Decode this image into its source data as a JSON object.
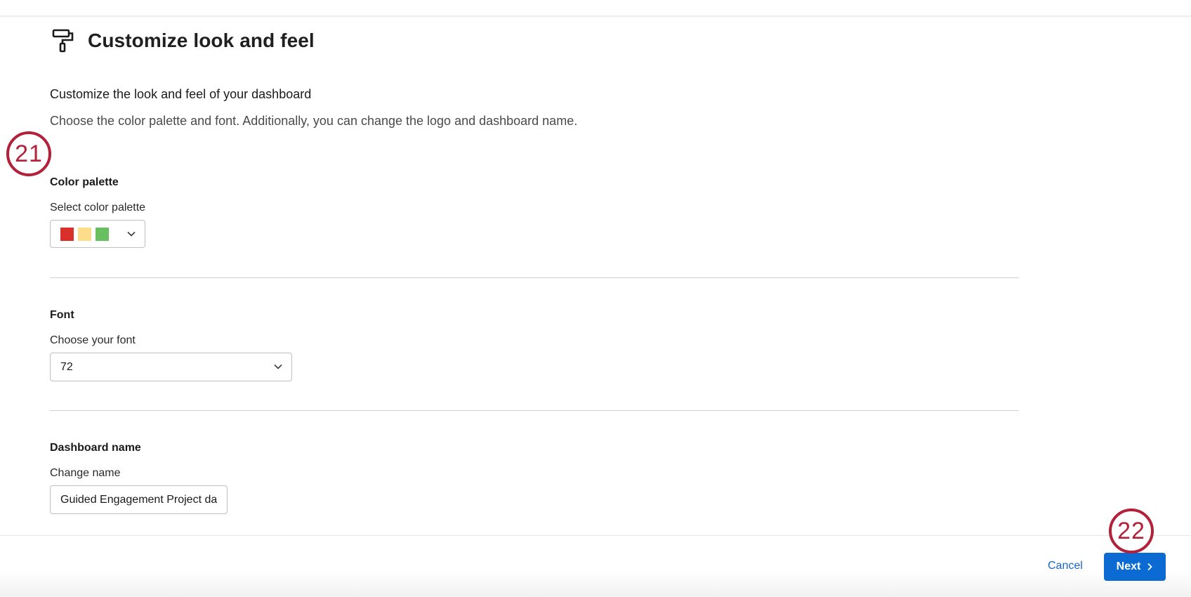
{
  "header": {
    "title": "Customize look and feel",
    "icon": "paint-roller-icon"
  },
  "intro": {
    "title": "Customize the look and feel of your dashboard",
    "description": "Choose the color palette and font. Additionally, you can change the logo and dashboard name."
  },
  "steps": {
    "palette_step": "21",
    "next_step": "22"
  },
  "color_palette": {
    "section_title": "Color palette",
    "label": "Select color palette",
    "swatches": [
      "#d9302c",
      "#fddc8a",
      "#68bf5f"
    ]
  },
  "font": {
    "section_title": "Font",
    "label": "Choose your font",
    "value": "72"
  },
  "dashboard_name": {
    "section_title": "Dashboard name",
    "label": "Change name",
    "value": "Guided Engagement Project dashboard"
  },
  "footer": {
    "cancel_label": "Cancel",
    "next_label": "Next"
  },
  "colors": {
    "primary": "#0b6bd3",
    "link": "#1a64c8",
    "step_marker": "#b3203a"
  }
}
